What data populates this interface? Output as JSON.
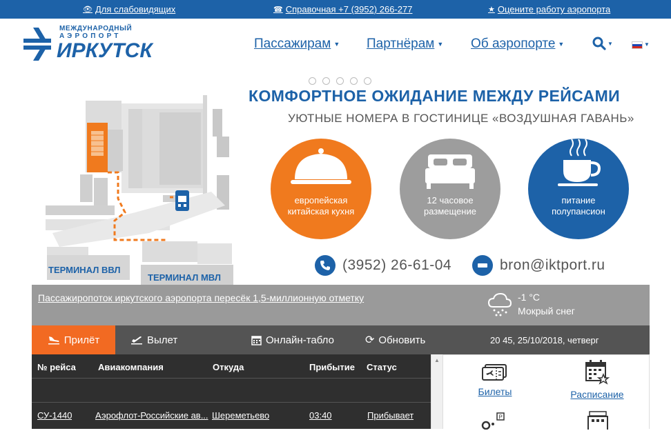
{
  "topbar": {
    "accessibility": "Для слабовидящих",
    "phone": "Справочная +7 (3952) 266-277",
    "rate": "Оцените работу аэропорта"
  },
  "logo": {
    "line1": "МЕЖДУНАРОДНЫЙ",
    "line2": "АЭРОПОРТ",
    "line3": "ИРКУТСК"
  },
  "nav": {
    "passengers": "Пассажирам",
    "partners": "Партнёрам",
    "about": "Об аэропорте"
  },
  "banner": {
    "headline": "КОМФОРТНОЕ ОЖИДАНИЕ МЕЖДУ РЕЙСАМИ",
    "subline": "УЮТНЫЕ НОМЕРА В ГОСТИНИЦЕ «ВОЗДУШНАЯ ГАВАНЬ»",
    "circle1_l1": "европейская",
    "circle1_l2": "китайская кухня",
    "circle2_l1": "12 часовое",
    "circle2_l2": "размещение",
    "circle3_l1": "питание",
    "circle3_l2": "полупансион",
    "terminal1": "ТЕРМИНАЛ ВВЛ",
    "terminal2": "ТЕРМИНАЛ МВЛ",
    "phone": "(3952) 26-61-04",
    "email": "bron@iktport.ru",
    "colors": {
      "blue": "#1d62a8",
      "orange": "#f07a1e",
      "gray": "#9d9d9d"
    }
  },
  "news": {
    "text": "Пассажиропоток иркутского аэропорта пересёк 1,5-миллионную отметку"
  },
  "weather": {
    "temp": "-1 °C",
    "desc": "Мокрый снег"
  },
  "tabs": {
    "arrival": "Прилёт",
    "departure": "Вылет",
    "online": "Онлайн-табло",
    "refresh": "Обновить",
    "datetime": "20 45, 25/10/2018, четверг"
  },
  "table": {
    "headers": [
      "№ рейса",
      "Авиакомпания",
      "Откуда",
      "Прибытие",
      "Статус"
    ],
    "rows": [
      {
        "flight": "СУ-1440",
        "airline": "Аэрофлот-Российские ав...",
        "from": "Шереметьево",
        "arrival": "03:40",
        "status": "Прибывает"
      }
    ]
  },
  "side": {
    "tickets": "Билеты",
    "schedule": "Расписание"
  }
}
